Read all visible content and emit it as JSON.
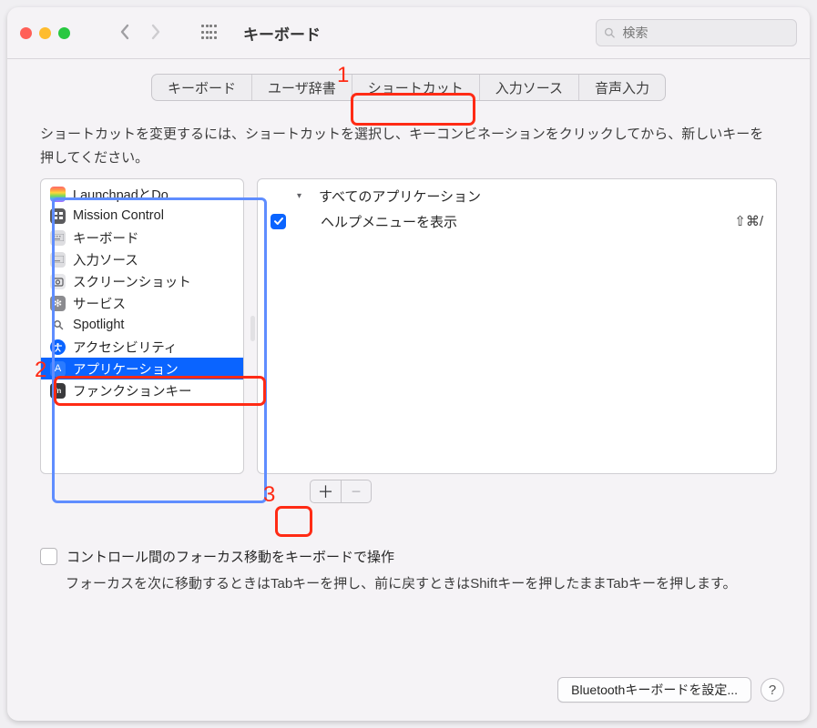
{
  "window": {
    "title": "キーボード"
  },
  "search": {
    "placeholder": "検索"
  },
  "tabs": {
    "items": [
      {
        "label": "キーボード"
      },
      {
        "label": "ユーザ辞書"
      },
      {
        "label": "ショートカット"
      },
      {
        "label": "入力ソース"
      },
      {
        "label": "音声入力"
      }
    ],
    "selected_index": 2
  },
  "instruction": "ショートカットを変更するには、ショートカットを選択し、キーコンビネーションをクリックしてから、新しいキーを押してください。",
  "sidebar": {
    "items": [
      {
        "icon": "launchpad-icon",
        "label": "LaunchpadとDo..."
      },
      {
        "icon": "mission-control-icon",
        "label": "Mission Control"
      },
      {
        "icon": "keyboard-icon",
        "label": "キーボード"
      },
      {
        "icon": "input-source-icon",
        "label": "入力ソース"
      },
      {
        "icon": "screenshot-icon",
        "label": "スクリーンショット"
      },
      {
        "icon": "gear-icon",
        "label": "サービス"
      },
      {
        "icon": "search-icon",
        "label": "Spotlight"
      },
      {
        "icon": "accessibility-icon",
        "label": "アクセシビリティ"
      },
      {
        "icon": "app-icon",
        "label": "アプリケーション"
      },
      {
        "icon": "fn-icon",
        "label": "ファンクションキー"
      }
    ],
    "selected_index": 8
  },
  "detail": {
    "group_label": "すべてのアプリケーション",
    "rows": [
      {
        "checked": true,
        "label": "ヘルプメニューを表示",
        "shortcut": "⇧⌘/"
      }
    ]
  },
  "footer": {
    "focus_checkbox_label": "コントロール間のフォーカス移動をキーボードで操作",
    "focus_checkbox_checked": false,
    "focus_description": "フォーカスを次に移動するときはTabキーを押し、前に戻すときはShiftキーを押したままTabキーを押します。"
  },
  "bluetooth_button": "Bluetoothキーボードを設定...",
  "help_button": "?",
  "annotations": {
    "n1": "1",
    "n2": "2",
    "n3": "3"
  }
}
